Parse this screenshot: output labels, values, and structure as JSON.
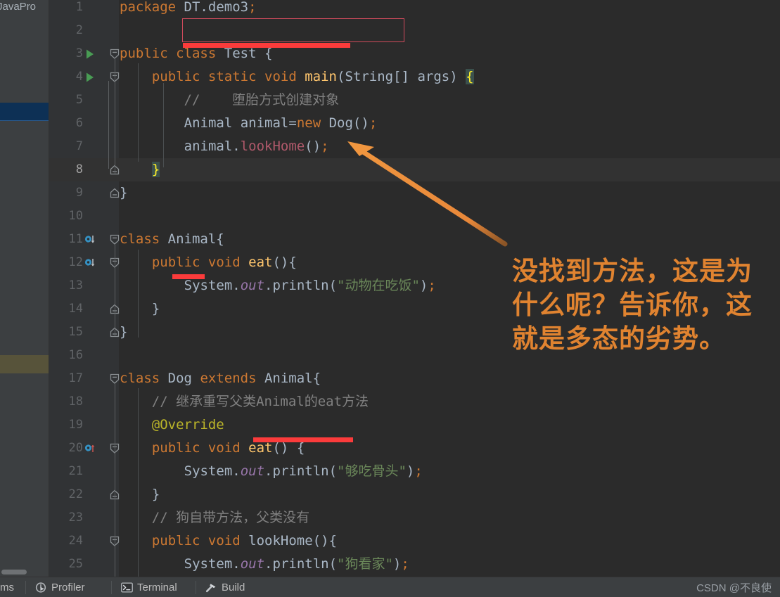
{
  "left_panel": {
    "title": "JavaPro",
    "selected_band_color": "#0d3055",
    "modified_band_color": "#57533a"
  },
  "editor": {
    "background": "#2b2b2b",
    "gutter_background": "#313335",
    "caret_line": 8,
    "lines": [
      {
        "num": "1",
        "gutter": "none",
        "fold": "none",
        "text": "package DT.demo3;"
      },
      {
        "num": "2",
        "gutter": "none",
        "fold": "none",
        "text": ""
      },
      {
        "num": "3",
        "gutter": "run",
        "fold": "collapse",
        "text": "public class Test {"
      },
      {
        "num": "4",
        "gutter": "run",
        "fold": "collapse",
        "text": "    public static void main(String[] args) {"
      },
      {
        "num": "5",
        "gutter": "none",
        "fold": "none",
        "text": "        //    堕胎方式创建对象"
      },
      {
        "num": "6",
        "gutter": "none",
        "fold": "none",
        "text": "        Animal animal=new Dog();"
      },
      {
        "num": "7",
        "gutter": "none",
        "fold": "none",
        "text": "        animal.lookHome();"
      },
      {
        "num": "8",
        "gutter": "none",
        "fold": "end",
        "text": "    }"
      },
      {
        "num": "9",
        "gutter": "none",
        "fold": "end",
        "text": "}"
      },
      {
        "num": "10",
        "gutter": "none",
        "fold": "none",
        "text": ""
      },
      {
        "num": "11",
        "gutter": "implemented",
        "fold": "collapse",
        "text": "class Animal{"
      },
      {
        "num": "12",
        "gutter": "implemented",
        "fold": "collapse",
        "text": "    public void eat(){"
      },
      {
        "num": "13",
        "gutter": "none",
        "fold": "none",
        "text": "        System.out.println(\"动物在吃饭\");"
      },
      {
        "num": "14",
        "gutter": "none",
        "fold": "end",
        "text": "    }"
      },
      {
        "num": "15",
        "gutter": "none",
        "fold": "end",
        "text": "}"
      },
      {
        "num": "16",
        "gutter": "none",
        "fold": "none",
        "text": ""
      },
      {
        "num": "17",
        "gutter": "none",
        "fold": "collapse",
        "text": "class Dog extends Animal{"
      },
      {
        "num": "18",
        "gutter": "none",
        "fold": "none",
        "text": "    // 继承重写父类Animal的eat方法"
      },
      {
        "num": "19",
        "gutter": "none",
        "fold": "none",
        "text": "    @Override"
      },
      {
        "num": "20",
        "gutter": "overriding",
        "fold": "collapse",
        "text": "    public void eat() {"
      },
      {
        "num": "21",
        "gutter": "none",
        "fold": "none",
        "text": "        System.out.println(\"够吃骨头\");"
      },
      {
        "num": "22",
        "gutter": "none",
        "fold": "end",
        "text": "    }"
      },
      {
        "num": "23",
        "gutter": "none",
        "fold": "none",
        "text": "    // 狗自带方法，父类没有"
      },
      {
        "num": "24",
        "gutter": "none",
        "fold": "collapse",
        "text": "    public void lookHome(){"
      },
      {
        "num": "25",
        "gutter": "none",
        "fold": "none",
        "text": "        System.out.println(\"狗看家\");"
      }
    ]
  },
  "annotations": {
    "note_text": "没找到方法，这是为什么呢？告诉你，这就是多态的劣势。",
    "note_color": "#e08330",
    "arrow_color": "#e8883a",
    "redbox_color": "#d14b5c",
    "redline_color": "#fb3b3b",
    "boxed_code_line": 6,
    "underlined_items": [
      "animal.lookHome();",
      "Dog",
      "lookHome"
    ]
  },
  "bottom_bar": {
    "items": [
      {
        "label": "ms",
        "icon": "none"
      },
      {
        "label": "Profiler",
        "icon": "profiler-icon"
      },
      {
        "label": "Terminal",
        "icon": "terminal-icon"
      },
      {
        "label": "Build",
        "icon": "build-hammer-icon"
      }
    ],
    "watermark": "CSDN @不良使"
  }
}
